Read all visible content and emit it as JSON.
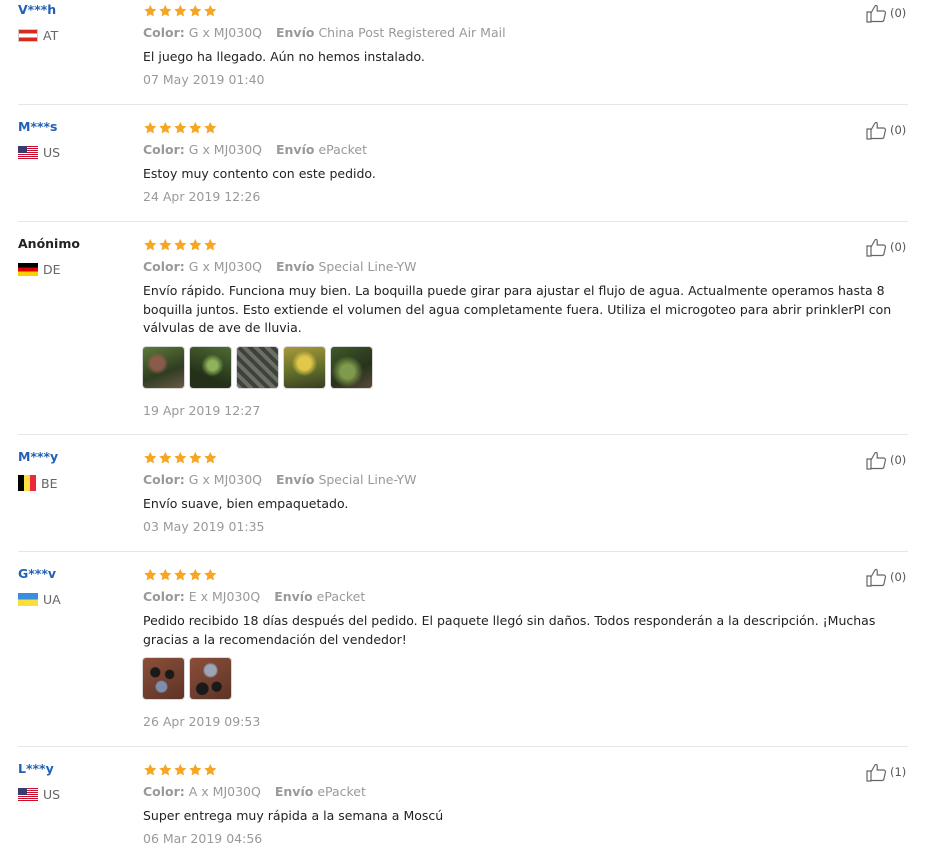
{
  "labels": {
    "color": "Color:",
    "shipping": "Envío"
  },
  "reviews": [
    {
      "user": "V***h",
      "country": "AT",
      "rating": 5,
      "color": "G x MJ030Q",
      "shipping": "China Post Registered Air Mail",
      "text": "El juego ha llegado. Aún no hemos instalado.",
      "date": "07 May 2019 01:40",
      "likes": "(0)"
    },
    {
      "user": "M***s",
      "country": "US",
      "rating": 5,
      "color": "G x MJ030Q",
      "shipping": "ePacket",
      "text": "Estoy muy contento con este pedido.",
      "date": "24 Apr 2019 12:26",
      "likes": "(0)"
    },
    {
      "user": "Anónimo",
      "country": "DE",
      "rating": 5,
      "color": "G x MJ030Q",
      "shipping": "Special Line-YW",
      "text": "Envío rápido. Funciona muy bien. La boquilla puede girar para ajustar el flujo de agua. Actualmente operamos hasta 8 boquilla juntos. Esto extiende el volumen del agua completamente fuera. Utiliza el microgoteo para abrir prinklerPI con válvulas de ave de lluvia.",
      "date": "19 Apr 2019 12:27",
      "likes": "(0)"
    },
    {
      "user": "M***y",
      "country": "BE",
      "rating": 5,
      "color": "G x MJ030Q",
      "shipping": "Special Line-YW",
      "text": "Envío suave, bien empaquetado.",
      "date": "03 May 2019 01:35",
      "likes": "(0)"
    },
    {
      "user": "G***v",
      "country": "UA",
      "rating": 5,
      "color": "E x MJ030Q",
      "shipping": "ePacket",
      "text": "Pedido recibido 18 días después del pedido. El paquete llegó sin daños. Todos responderán a la descripción. ¡Muchas gracias a la recomendación del vendedor!",
      "date": "26 Apr 2019 09:53",
      "likes": "(0)"
    },
    {
      "user": "L***y",
      "country": "US",
      "rating": 5,
      "color": "A x MJ030Q",
      "shipping": "ePacket",
      "text": "Super entrega muy rápida a la semana a Moscú",
      "date": "06 Mar 2019 04:56",
      "likes": "(1)"
    }
  ],
  "colors": {
    "star": "#f6a623",
    "user_link": "#2160b6",
    "muted": "#999999"
  }
}
